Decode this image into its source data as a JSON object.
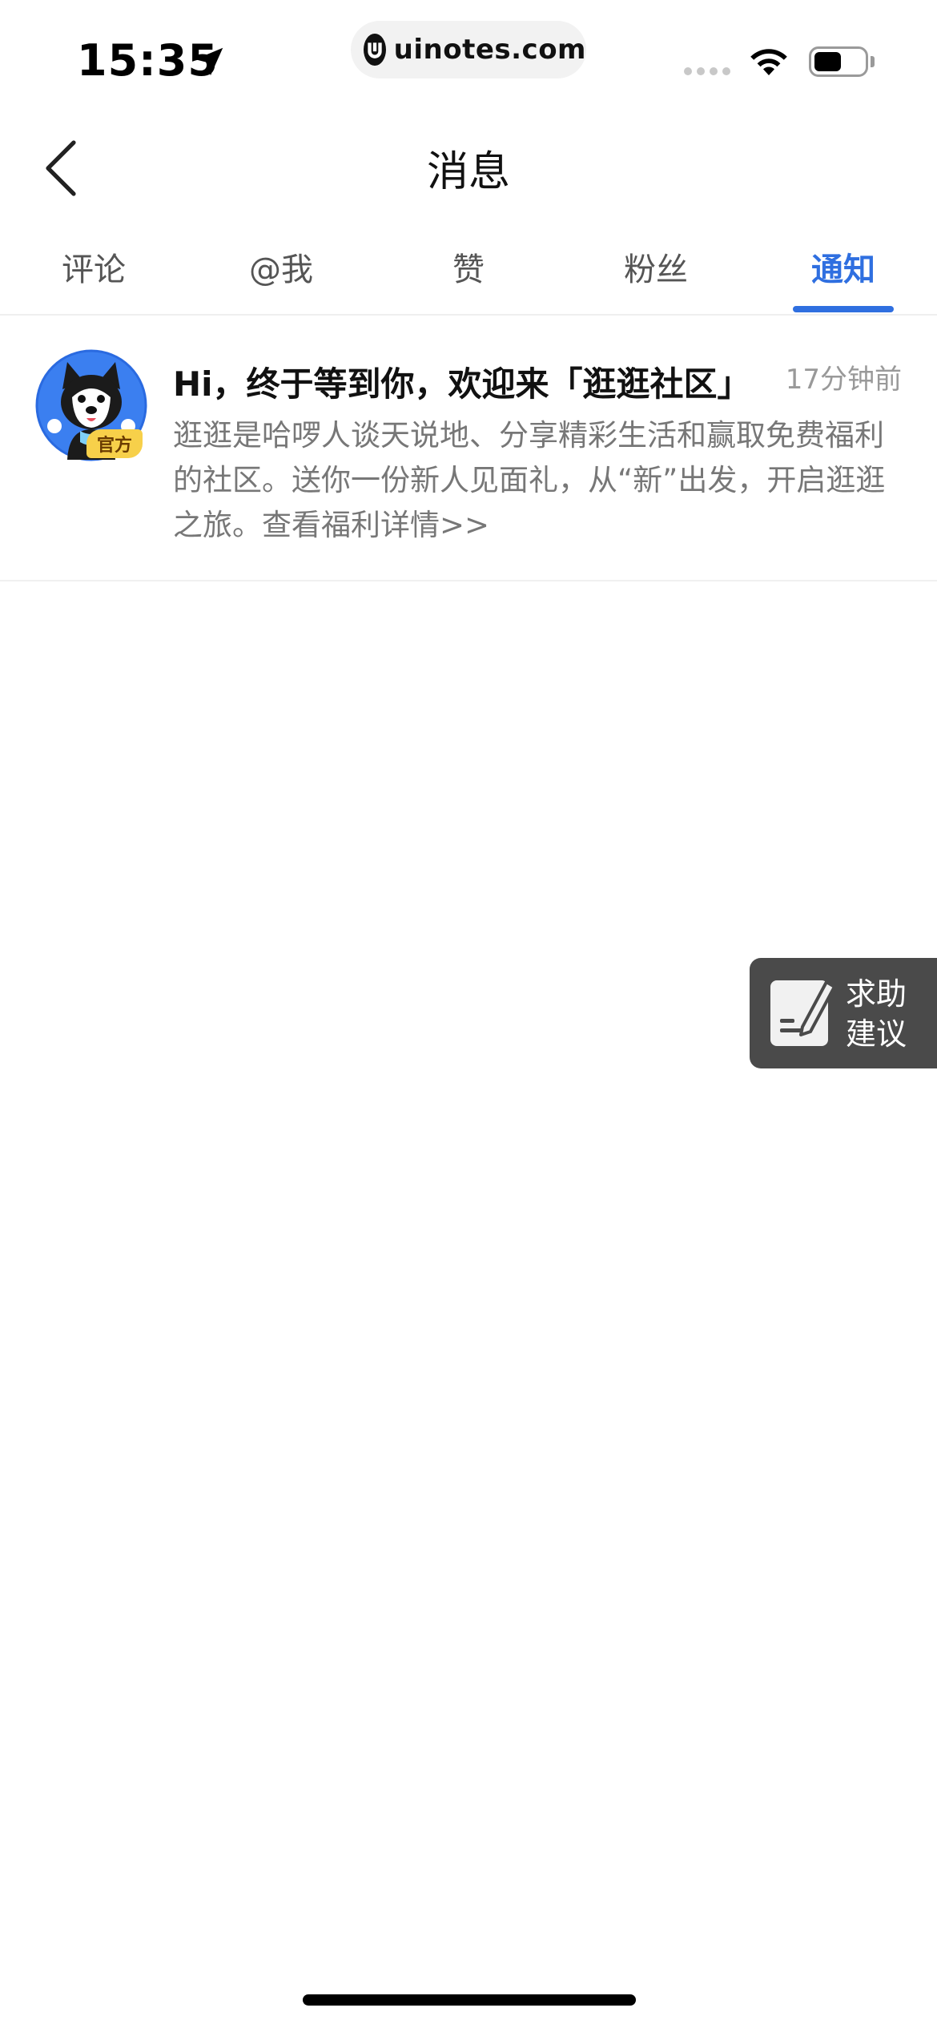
{
  "status": {
    "time": "15:35",
    "url": "uinotes.com",
    "battery_level": 0.55
  },
  "nav": {
    "title": "消息"
  },
  "tabs": [
    {
      "label": "评论"
    },
    {
      "label": "@我"
    },
    {
      "label": "赞"
    },
    {
      "label": "粉丝"
    },
    {
      "label": "通知"
    }
  ],
  "active_tab": "通知",
  "message": {
    "badge": "官方",
    "title": "Hi，终于等到你，欢迎来「逛逛社区」",
    "time": "17分钟前",
    "body": "逛逛是哈啰人谈天说地、分享精彩生活和赢取免费福利的社区。送你一份新人见面礼，从“新”出发，开启逛逛之旅。查看福利详情>>"
  },
  "help": {
    "line1": "求助",
    "line2": "建议"
  },
  "colors": {
    "accent": "#2f6fe0",
    "help_bg": "#4a4a4a",
    "badge": "#f7d04a"
  }
}
